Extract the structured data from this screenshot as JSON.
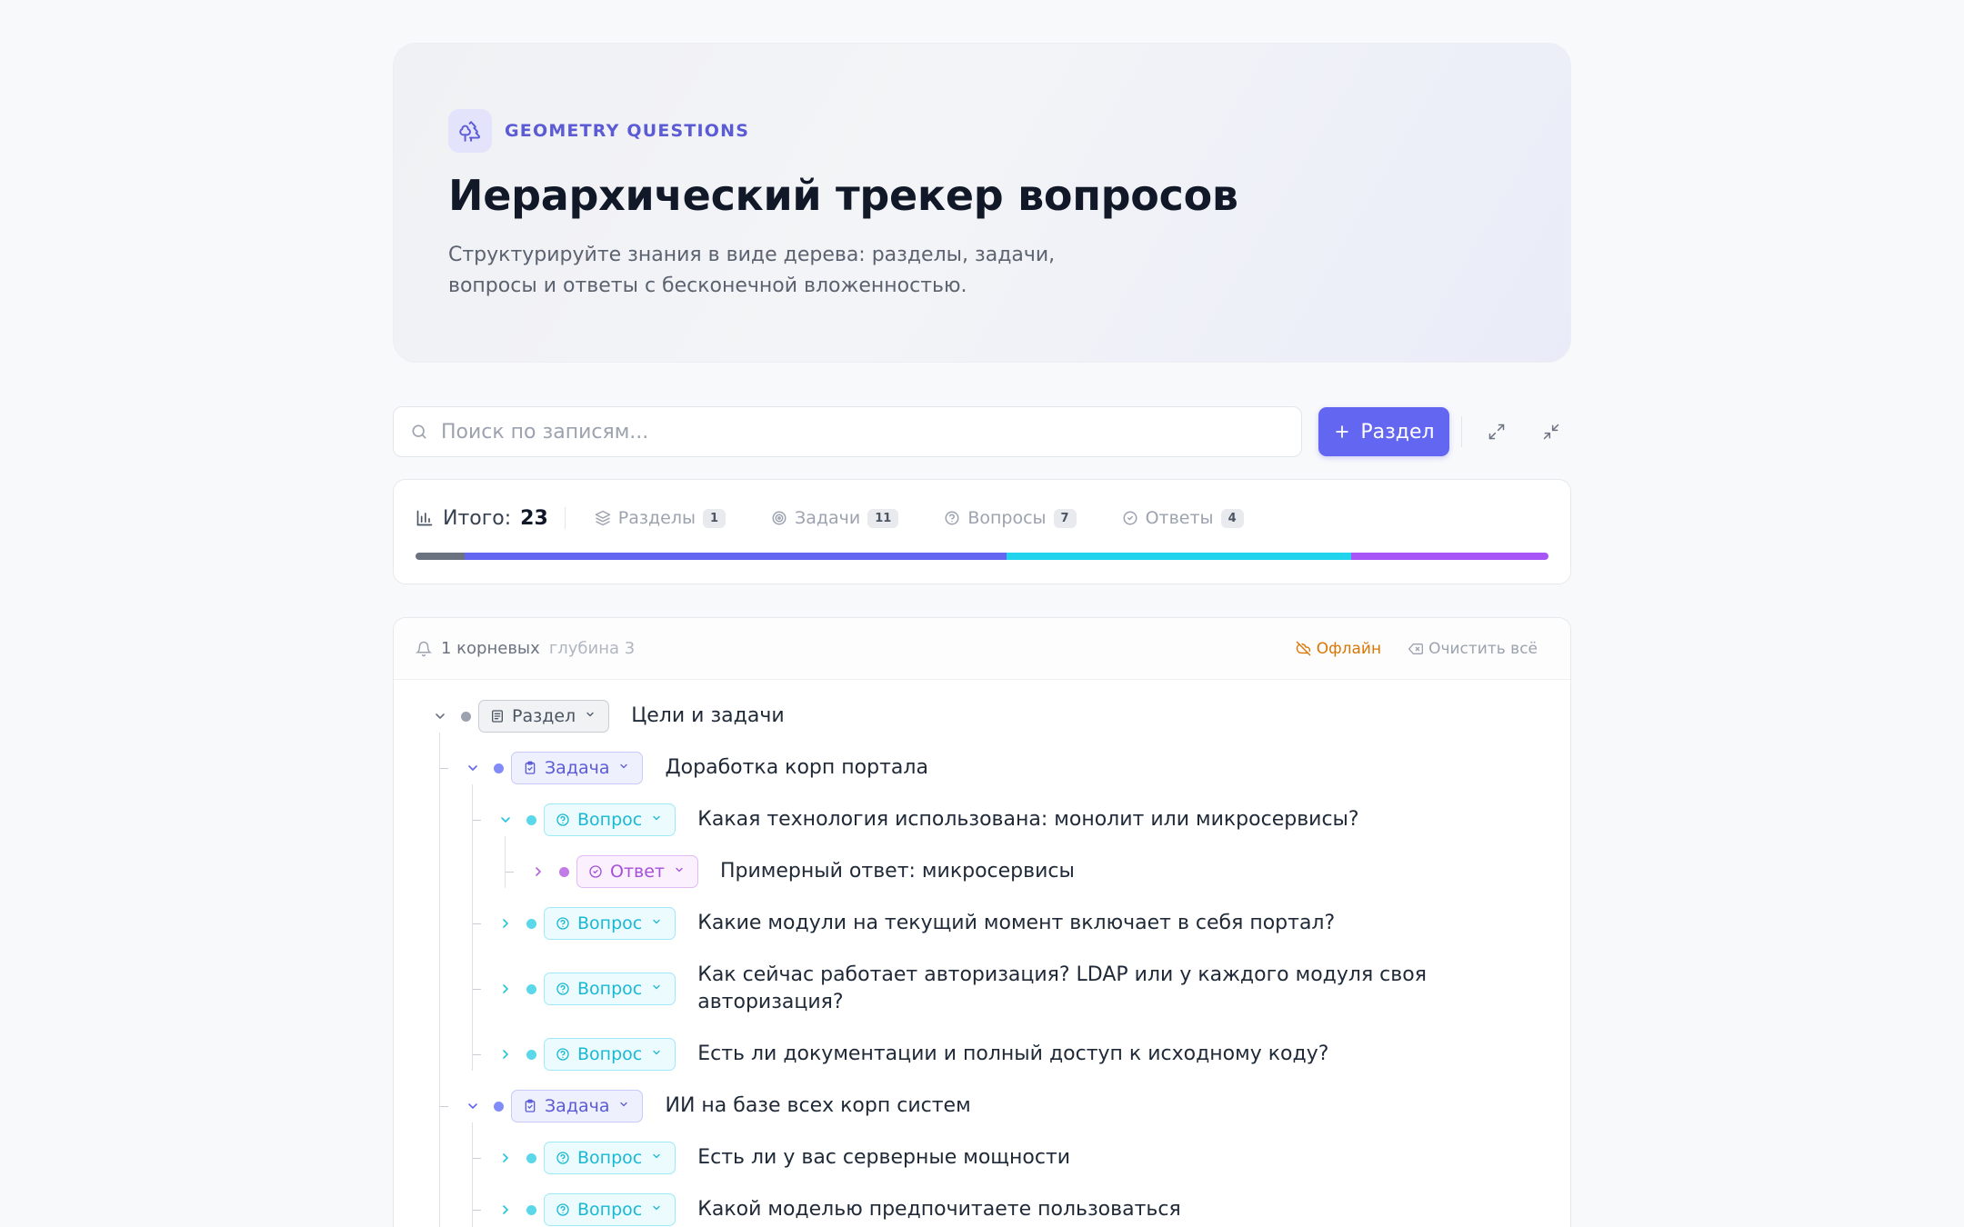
{
  "header": {
    "brand_label": "GEOMETRY QUESTIONS",
    "title": "Иерархический трекер вопросов",
    "subtitle_line1": "Структурируйте знания в виде дерева: разделы, задачи,",
    "subtitle_line2": "вопросы и ответы с бесконечной вложенностью."
  },
  "toolbar": {
    "search_placeholder": "Поиск по записям...",
    "search_value": "",
    "add_section_label": "Раздел",
    "icons": [
      "search-icon",
      "plus-icon",
      "expand-all-icon",
      "collapse-all-icon"
    ]
  },
  "stats": {
    "total_label": "Итого:",
    "total_value": "23",
    "items": [
      {
        "label": "Разделы",
        "count": "1",
        "icon": "layers-icon"
      },
      {
        "label": "Задачи",
        "count": "11",
        "icon": "target-icon"
      },
      {
        "label": "Вопросы",
        "count": "7",
        "icon": "question-circle-icon"
      },
      {
        "label": "Ответы",
        "count": "4",
        "icon": "check-circle-icon"
      }
    ],
    "progress": [
      {
        "type": "section",
        "fraction": 0.0435,
        "color": "#6b7280"
      },
      {
        "type": "task",
        "fraction": 0.4783,
        "color": "#6366f1"
      },
      {
        "type": "question",
        "fraction": 0.3043,
        "color": "#22d3ee"
      },
      {
        "type": "answer",
        "fraction": 0.1739,
        "color": "#a855f7"
      }
    ]
  },
  "tree_header": {
    "roots_label": "1 корневых",
    "depth_label": "глубина 3",
    "offline_label": "Офлайн",
    "clear_label": "Очистить всё"
  },
  "tree": {
    "rows": [
      {
        "level": 0,
        "expanded": true,
        "type": "section",
        "badge": "Раздел",
        "text": "Цели и задачи"
      },
      {
        "level": 1,
        "expanded": true,
        "type": "task",
        "badge": "Задача",
        "text": "Доработка корп портала"
      },
      {
        "level": 2,
        "expanded": true,
        "type": "question",
        "badge": "Вопрос",
        "text": "Какая технология использована: монолит или микросервисы?"
      },
      {
        "level": 3,
        "expanded": false,
        "type": "answer",
        "badge": "Ответ",
        "text": "Примерный ответ: микросервисы"
      },
      {
        "level": 2,
        "expanded": false,
        "type": "question",
        "badge": "Вопрос",
        "text": "Какие модули на текущий момент включает в себя портал?"
      },
      {
        "level": 2,
        "expanded": false,
        "type": "question",
        "badge": "Вопрос",
        "text": "Как сейчас работает авторизация? LDAP или у каждого модуля своя",
        "text2": "авторизация?"
      },
      {
        "level": 2,
        "expanded": false,
        "type": "question",
        "badge": "Вопрос",
        "text": "Есть ли документации и полный доступ к исходному коду?"
      },
      {
        "level": 1,
        "expanded": true,
        "type": "task",
        "badge": "Задача",
        "text": "ИИ на базе всех корп систем"
      },
      {
        "level": 2,
        "expanded": false,
        "type": "question",
        "badge": "Вопрос",
        "text": "Есть ли у вас серверные мощности"
      },
      {
        "level": 2,
        "expanded": false,
        "type": "question",
        "badge": "Вопрос",
        "text": "Какой моделью предпочитаете пользоваться"
      }
    ]
  }
}
